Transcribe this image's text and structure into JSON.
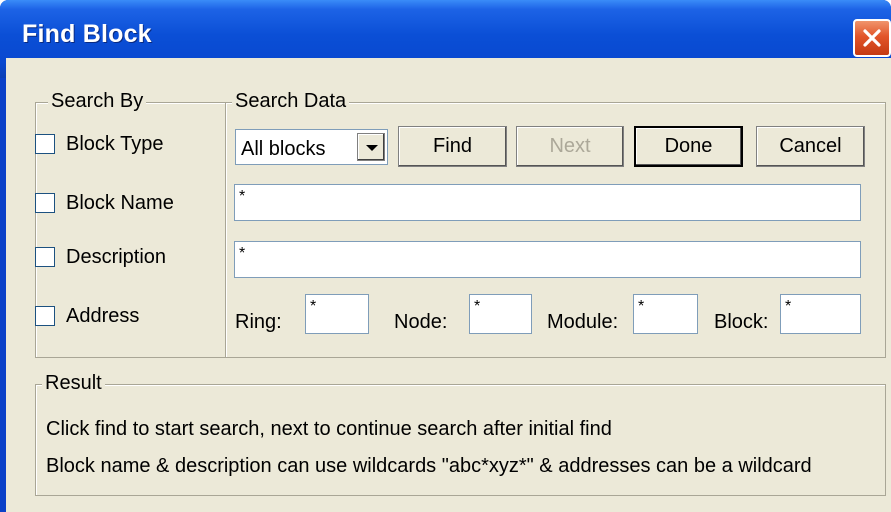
{
  "window": {
    "title": "Find Block"
  },
  "search_by": {
    "group_label": "Search By",
    "options": [
      {
        "label": "Block Type",
        "checked": false
      },
      {
        "label": "Block Name",
        "checked": false
      },
      {
        "label": "Description",
        "checked": false
      },
      {
        "label": "Address",
        "checked": false
      }
    ]
  },
  "search_data": {
    "group_label": "Search Data",
    "scope_select": {
      "selected": "All blocks"
    },
    "buttons": {
      "find": "Find",
      "next": "Next",
      "done": "Done",
      "cancel": "Cancel"
    },
    "fields": {
      "block_type": "*",
      "block_name": "*"
    },
    "address": {
      "ring_label": "Ring:",
      "ring_value": "*",
      "node_label": "Node:",
      "node_value": "*",
      "module_label": "Module:",
      "module_value": "*",
      "block_label": "Block:",
      "block_value": "*"
    }
  },
  "result": {
    "group_label": "Result",
    "line1": "Click find to start search, next to continue search after initial find",
    "line2": "Block name & description can use wildcards \"abc*xyz*\" & addresses can be a wildcard"
  },
  "colors": {
    "titlebar": "#0948d0",
    "close_button": "#e2552a",
    "dialog_face": "#ece9d8",
    "disabled_text": "#aca899"
  }
}
